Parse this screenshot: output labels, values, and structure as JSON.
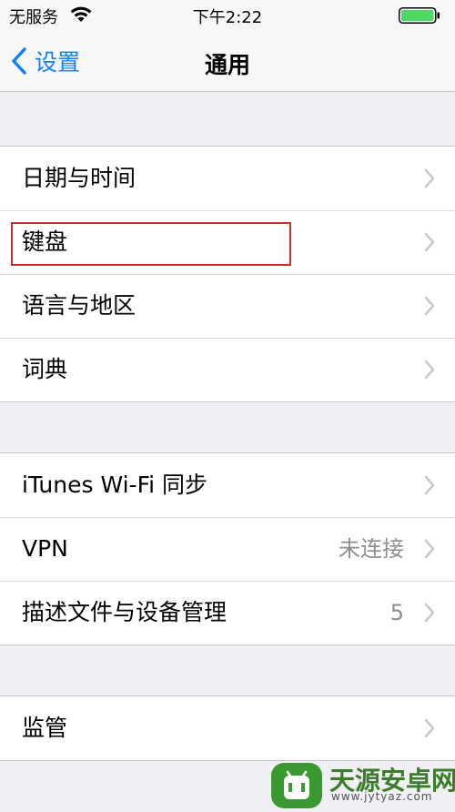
{
  "status_bar": {
    "carrier": "无服务",
    "time": "下午2:22",
    "battery_color": "#4cd964"
  },
  "nav": {
    "back_label": "设置",
    "title": "通用",
    "accent_color": "#157efb"
  },
  "groups": [
    {
      "rows": [
        {
          "label": "日期与时间",
          "detail": ""
        },
        {
          "label": "键盘",
          "detail": ""
        },
        {
          "label": "语言与地区",
          "detail": ""
        },
        {
          "label": "词典",
          "detail": ""
        }
      ]
    },
    {
      "rows": [
        {
          "label": "iTunes Wi-Fi 同步",
          "detail": ""
        },
        {
          "label": "VPN",
          "detail": "未连接"
        },
        {
          "label": "描述文件与设备管理",
          "detail": "5"
        }
      ]
    },
    {
      "rows": [
        {
          "label": "监管",
          "detail": ""
        }
      ]
    }
  ],
  "watermark": {
    "name": "天源安卓网",
    "url": "www.jytyaz.com"
  }
}
